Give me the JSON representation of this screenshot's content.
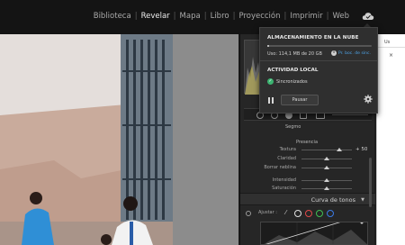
{
  "modules": [
    {
      "label": "Biblioteca",
      "active": false
    },
    {
      "label": "Revelar",
      "active": true
    },
    {
      "label": "Mapa",
      "active": false
    },
    {
      "label": "Libro",
      "active": false
    },
    {
      "label": "Proyección",
      "active": false
    },
    {
      "label": "Imprimir",
      "active": false
    },
    {
      "label": "Web",
      "active": false
    }
  ],
  "cloud_popover": {
    "storage_title": "ALMACENAMIENTO EN LA NUBE",
    "usage_text": "Uso: 114,1 MB de 20 GB",
    "usage_fraction": 0.0057,
    "sync_link": "Pr. boc. de sinc.",
    "activity_title": "ACTIVIDAD LOCAL",
    "status_text": "Sincronizados",
    "pause_label": "Pausar"
  },
  "develop_panel": {
    "section_label": "Segmo",
    "presence_label": "Presencia",
    "sliders": [
      {
        "label": "Textura",
        "value": "+ 50",
        "pos": 0.75
      },
      {
        "label": "Claridad",
        "value": "",
        "pos": 0.5
      },
      {
        "label": "Borrar neblina",
        "value": "",
        "pos": 0.5
      },
      {
        "label": "Intensidad",
        "value": "",
        "pos": 0.5
      },
      {
        "label": "Saturación",
        "value": "",
        "pos": 0.5
      }
    ],
    "tone_curve_title": "Curva de tonos",
    "adjust_label": "Ajustar :",
    "channel_colors": [
      "#e0e0e0",
      "#e04848",
      "#3fbf52",
      "#3a7ae6"
    ]
  },
  "browser_sliver": {
    "tab_text": "Us",
    "close_glyph": "×"
  },
  "colors": {
    "accent_link": "#4ea3e6",
    "synced_green": "#3cb371"
  }
}
